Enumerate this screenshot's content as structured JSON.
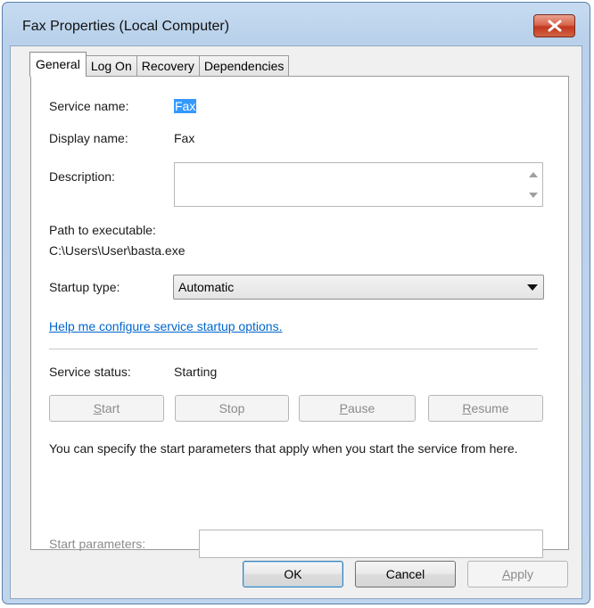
{
  "window": {
    "title": "Fax Properties (Local Computer)",
    "close_icon": "close-icon"
  },
  "tabs": [
    {
      "label": "General",
      "active": true
    },
    {
      "label": "Log On",
      "active": false
    },
    {
      "label": "Recovery",
      "active": false
    },
    {
      "label": "Dependencies",
      "active": false
    }
  ],
  "general": {
    "service_name_label": "Service name:",
    "service_name_value": "Fax",
    "display_name_label": "Display name:",
    "display_name_value": "Fax",
    "description_label": "Description:",
    "description_value": "",
    "path_label": "Path to executable:",
    "path_value": "C:\\Users\\User\\basta.exe",
    "startup_type_label": "Startup type:",
    "startup_type_value": "Automatic",
    "help_link": "Help me configure service startup options.",
    "service_status_label": "Service status:",
    "service_status_value": "Starting",
    "buttons": {
      "start": "Start",
      "stop": "Stop",
      "pause": "Pause",
      "resume": "Resume"
    },
    "params_info": "You can specify the start parameters that apply when you start the service from here.",
    "start_params_label": "Start parameters:",
    "start_params_value": ""
  },
  "footer": {
    "ok": "OK",
    "cancel": "Cancel",
    "apply": "Apply"
  },
  "colors": {
    "selection": "#3399ff",
    "link": "#0066cc",
    "disabled_text": "#8b8b8b"
  }
}
